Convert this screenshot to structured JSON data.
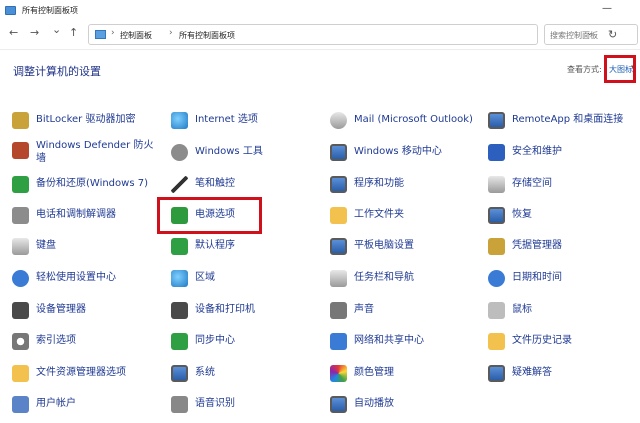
{
  "window": {
    "title": "所有控制面板项",
    "minimize_glyph": "—"
  },
  "nav": {
    "back_glyph": "←",
    "forward_glyph": "→",
    "dropdown_glyph": "⌄",
    "up_glyph": "↑",
    "breadcrumb_sep": "›",
    "crumbs": [
      "控制面板",
      "所有控制面板项"
    ],
    "address_dropdown_glyph": "⌄",
    "refresh_glyph": "↻",
    "search_placeholder": "搜索控制面板"
  },
  "header": {
    "title": "调整计算机的设置",
    "view_by_label": "查看方式:",
    "view_by_value": "大图标",
    "view_by_arrow": "▾"
  },
  "items": {
    "col1": [
      {
        "label": "BitLocker 驱动器加密",
        "icon": "bitlocker-key-icon"
      },
      {
        "label": "Windows Defender 防火墙",
        "icon": "firewall-icon"
      },
      {
        "label": "备份和还原(Windows 7)",
        "icon": "backup-icon"
      },
      {
        "label": "电话和调制解调器",
        "icon": "phone-modem-icon"
      },
      {
        "label": "键盘",
        "icon": "keyboard-icon"
      },
      {
        "label": "轻松使用设置中心",
        "icon": "ease-of-access-icon"
      },
      {
        "label": "设备管理器",
        "icon": "device-manager-icon"
      },
      {
        "label": "索引选项",
        "icon": "indexing-icon"
      },
      {
        "label": "文件资源管理器选项",
        "icon": "folder-options-icon"
      },
      {
        "label": "用户帐户",
        "icon": "user-accounts-icon"
      }
    ],
    "col2": [
      {
        "label": "Internet 选项",
        "icon": "internet-globe-icon"
      },
      {
        "label": "Windows 工具",
        "icon": "gear-icon"
      },
      {
        "label": "笔和触控",
        "icon": "pen-icon"
      },
      {
        "label": "电源选项",
        "icon": "power-options-icon"
      },
      {
        "label": "默认程序",
        "icon": "default-programs-icon"
      },
      {
        "label": "区域",
        "icon": "region-globe-icon"
      },
      {
        "label": "设备和打印机",
        "icon": "printer-icon"
      },
      {
        "label": "同步中心",
        "icon": "sync-icon"
      },
      {
        "label": "系统",
        "icon": "system-monitor-icon"
      },
      {
        "label": "语音识别",
        "icon": "microphone-icon"
      }
    ],
    "col3": [
      {
        "label": "Mail (Microsoft Outlook)",
        "icon": "mail-icon"
      },
      {
        "label": "Windows 移动中心",
        "icon": "mobility-center-icon"
      },
      {
        "label": "程序和功能",
        "icon": "programs-features-icon"
      },
      {
        "label": "工作文件夹",
        "icon": "work-folders-icon"
      },
      {
        "label": "平板电脑设置",
        "icon": "tablet-icon"
      },
      {
        "label": "任务栏和导航",
        "icon": "taskbar-icon"
      },
      {
        "label": "声音",
        "icon": "speaker-icon"
      },
      {
        "label": "网络和共享中心",
        "icon": "network-icon"
      },
      {
        "label": "颜色管理",
        "icon": "color-management-icon"
      },
      {
        "label": "自动播放",
        "icon": "autoplay-icon"
      }
    ],
    "col4": [
      {
        "label": "RemoteApp 和桌面连接",
        "icon": "remoteapp-icon"
      },
      {
        "label": "安全和维护",
        "icon": "security-flag-icon"
      },
      {
        "label": "存储空间",
        "icon": "storage-spaces-icon"
      },
      {
        "label": "恢复",
        "icon": "recovery-icon"
      },
      {
        "label": "凭据管理器",
        "icon": "credential-manager-icon"
      },
      {
        "label": "日期和时间",
        "icon": "clock-icon"
      },
      {
        "label": "鼠标",
        "icon": "mouse-icon"
      },
      {
        "label": "文件历史记录",
        "icon": "file-history-icon"
      },
      {
        "label": "疑难解答",
        "icon": "troubleshooting-icon"
      }
    ]
  },
  "highlight_color": "#d0101a",
  "link_color": "#1f3a93"
}
